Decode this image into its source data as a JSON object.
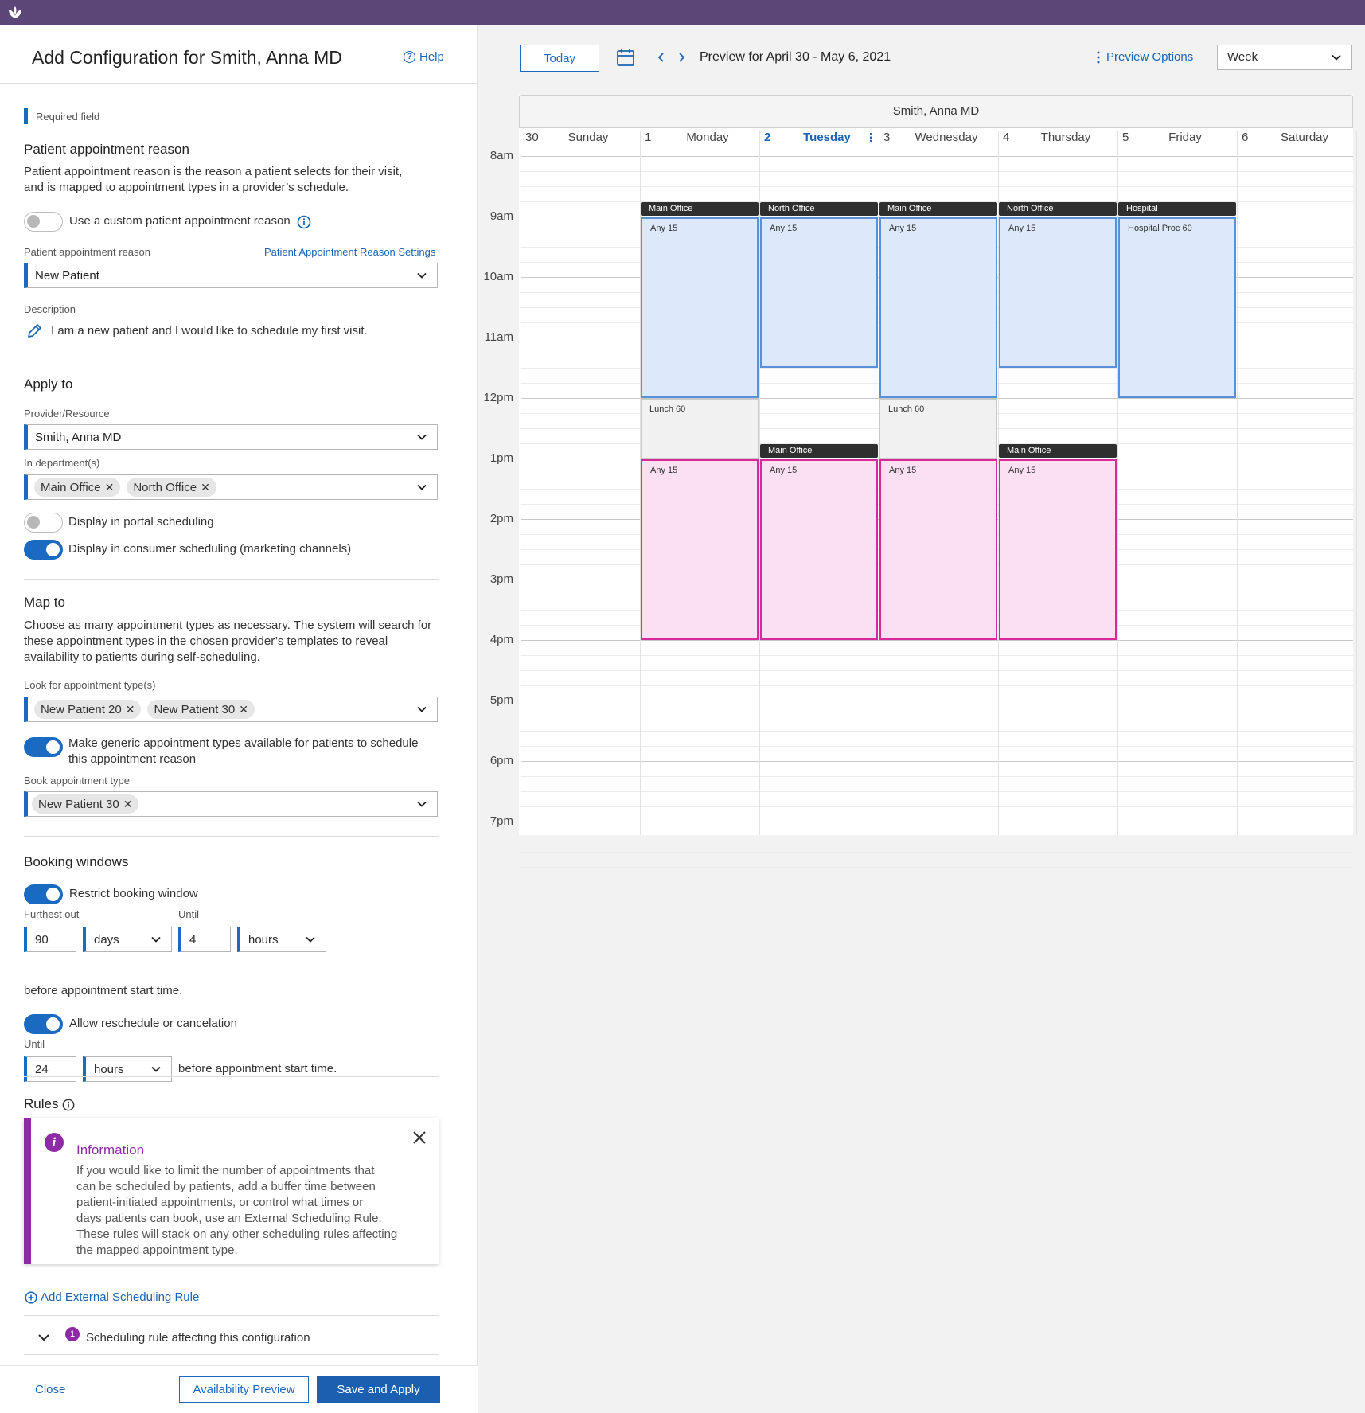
{
  "header": {
    "title": "Add Configuration for Smith, Anna MD",
    "help_label": "Help"
  },
  "required_field_label": "Required field",
  "reason_section": {
    "title": "Patient appointment reason",
    "description_line1": "Patient appointment reason is the reason a patient selects for their visit,",
    "description_line2": "and is mapped to appointment types in a provider’s schedule.",
    "custom_toggle_label": "Use a custom patient appointment reason",
    "custom_toggle_on": false,
    "reason_field_label": "Patient appointment reason",
    "reason_settings_link": "Patient Appointment Reason Settings",
    "reason_value": "New Patient",
    "desc_label": "Description",
    "desc_value": "I am a new patient and I would like to schedule my first visit."
  },
  "apply_section": {
    "title": "Apply to",
    "provider_label": "Provider/Resource",
    "provider_value": "Smith, Anna MD",
    "dept_label": "In department(s)",
    "departments": [
      "Main Office",
      "North Office"
    ],
    "portal_toggle_label": "Display in portal scheduling",
    "portal_on": false,
    "consumer_toggle_label": "Display in consumer scheduling (marketing channels)",
    "consumer_on": true
  },
  "map_section": {
    "title": "Map to",
    "desc_line1": "Choose as many appointment types as necessary. The system will search for",
    "desc_line2": "these appointment types in the chosen provider’s templates to reveal",
    "desc_line3": "availability to patients during self-scheduling.",
    "look_label": "Look for appointment type(s)",
    "look_types": [
      "New Patient 20",
      "New Patient 30"
    ],
    "generic_toggle_line1": "Make generic appointment types available for patients to schedule",
    "generic_toggle_line2": "this appointment reason",
    "generic_on": true,
    "book_label": "Book appointment type",
    "book_types": [
      "New Patient 30"
    ]
  },
  "booking_section": {
    "title": "Booking windows",
    "restrict_label": "Restrict booking window",
    "restrict_on": true,
    "furthest_label": "Furthest out",
    "furthest_value": "90",
    "furthest_unit": "days",
    "until_label": "Until",
    "until_value": "4",
    "until_unit": "hours",
    "before_text": "before appointment start time.",
    "reschedule_label": "Allow reschedule or cancelation",
    "reschedule_on": true,
    "until2_label": "Until",
    "until2_value": "24",
    "until2_unit": "hours",
    "before_text2": "before appointment start time."
  },
  "rules_section": {
    "title": "Rules",
    "info_title": "Information",
    "info_lines": [
      "If you would like to limit the number of appointments that",
      "can be scheduled by patients, add a buffer time between",
      "patient-initiated appointments, or control what times or",
      "days patients can book, use an External Scheduling Rule.",
      "These rules will stack on any other scheduling rules affecting",
      "the mapped appointment type."
    ],
    "add_rule_label": "Add External Scheduling Rule",
    "affecting_count": "1",
    "affecting_label": "Scheduling rule affecting this configuration"
  },
  "footer": {
    "close_label": "Close",
    "preview_label": "Availability Preview",
    "save_label": "Save and Apply"
  },
  "preview_toolbar": {
    "today_label": "Today",
    "range_label": "Preview for April 30 - May 6, 2021",
    "options_label": "Preview Options",
    "view_value": "Week"
  },
  "calendar": {
    "provider_name": "Smith, Anna MD",
    "days": [
      {
        "num": "30",
        "name": "Sunday",
        "today": false
      },
      {
        "num": "1",
        "name": "Monday",
        "today": false
      },
      {
        "num": "2",
        "name": "Tuesday",
        "today": true
      },
      {
        "num": "3",
        "name": "Wednesday",
        "today": false
      },
      {
        "num": "4",
        "name": "Thursday",
        "today": false
      },
      {
        "num": "5",
        "name": "Friday",
        "today": false
      },
      {
        "num": "6",
        "name": "Saturday",
        "today": false
      }
    ],
    "hours": [
      "8am",
      "9am",
      "10am",
      "11am",
      "12pm",
      "1pm",
      "2pm",
      "3pm",
      "4pm",
      "5pm",
      "6pm",
      "7pm"
    ],
    "blocks": [
      {
        "day": 1,
        "start": 9.0,
        "end": 12.0,
        "kind": "blue",
        "label": "Any 15",
        "location": "Main Office"
      },
      {
        "day": 2,
        "start": 9.0,
        "end": 11.5,
        "kind": "blue",
        "label": "Any 15",
        "location": "North Office"
      },
      {
        "day": 3,
        "start": 9.0,
        "end": 12.0,
        "kind": "blue",
        "label": "Any 15",
        "location": "Main Office"
      },
      {
        "day": 4,
        "start": 9.0,
        "end": 11.5,
        "kind": "blue",
        "label": "Any 15",
        "location": "North Office"
      },
      {
        "day": 5,
        "start": 9.0,
        "end": 12.0,
        "kind": "blue",
        "label": "Hospital Proc 60",
        "location": "Hospital"
      },
      {
        "day": 1,
        "start": 12.0,
        "end": 13.0,
        "kind": "gray",
        "label": "Lunch 60",
        "location": ""
      },
      {
        "day": 3,
        "start": 12.0,
        "end": 13.0,
        "kind": "gray",
        "label": "Lunch 60",
        "location": ""
      },
      {
        "day": 1,
        "start": 13.0,
        "end": 16.0,
        "kind": "pink",
        "label": "Any 15",
        "location": ""
      },
      {
        "day": 2,
        "start": 13.0,
        "end": 16.0,
        "kind": "pink",
        "label": "Any 15",
        "location": "Main Office"
      },
      {
        "day": 3,
        "start": 13.0,
        "end": 16.0,
        "kind": "pink",
        "label": "Any 15",
        "location": ""
      },
      {
        "day": 4,
        "start": 13.0,
        "end": 16.0,
        "kind": "pink",
        "label": "Any 15",
        "location": "Main Office"
      }
    ]
  },
  "colors": {
    "brand_bar": "#5c4577",
    "accent": "#1b6ac1",
    "info_accent": "#8f2aa6",
    "today": "#1a64b6"
  }
}
